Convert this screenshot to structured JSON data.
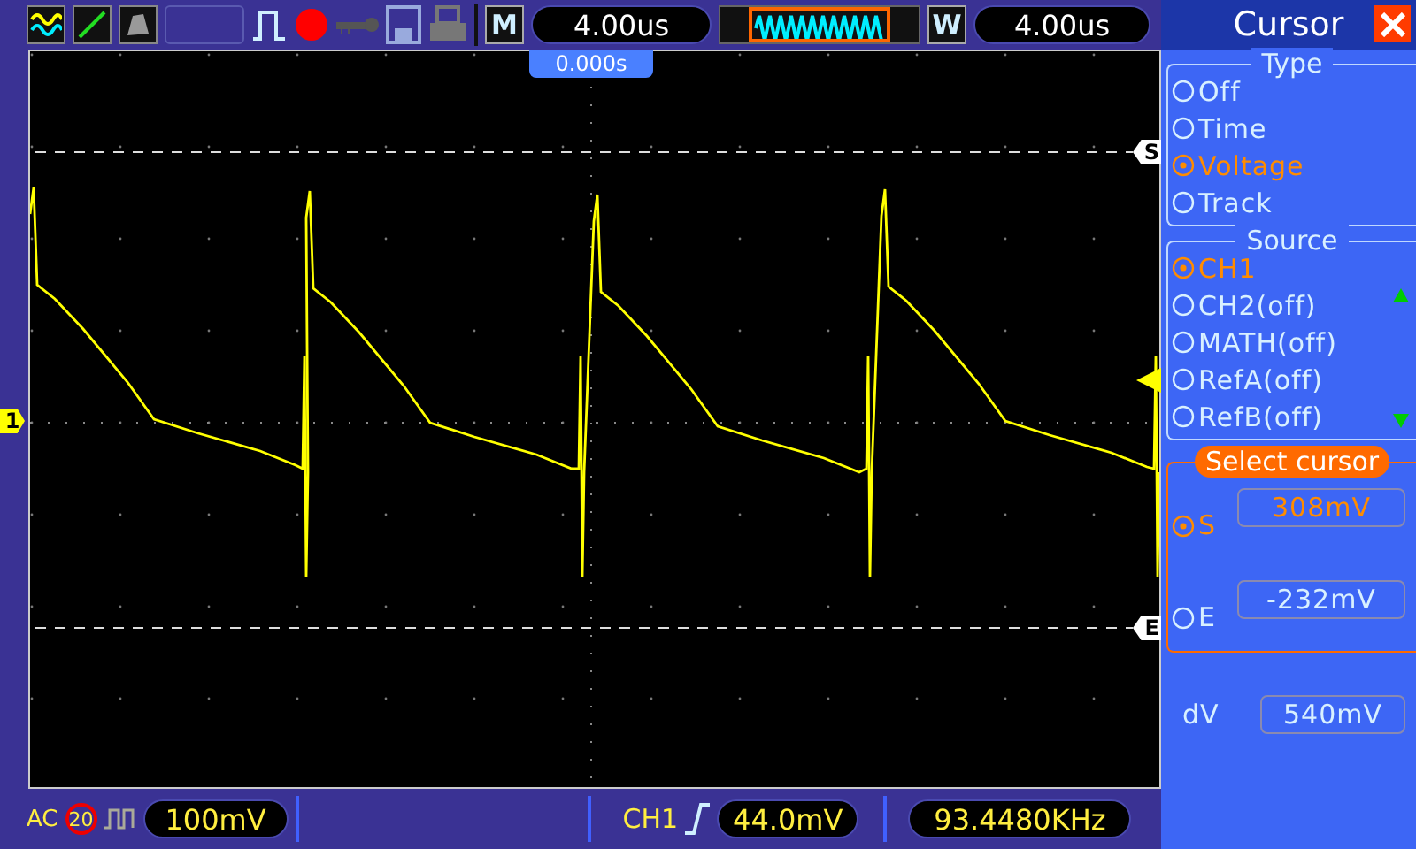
{
  "top_bar": {
    "mode_label": "M",
    "main_timebase": "4.00us",
    "window_label": "W",
    "window_timebase": "4.00us",
    "running": true
  },
  "screen": {
    "trigger_position": "0.000s",
    "channel_marker": "1",
    "start_cursor_marker": "S",
    "end_cursor_marker": "E"
  },
  "panel": {
    "title": "Cursor",
    "type_group": {
      "title": "Type",
      "options": [
        {
          "label": "Off",
          "selected": false
        },
        {
          "label": "Time",
          "selected": false
        },
        {
          "label": "Voltage",
          "selected": true
        },
        {
          "label": "Track",
          "selected": false
        }
      ]
    },
    "source_group": {
      "title": "Source",
      "options": [
        {
          "label": "CH1",
          "selected": true
        },
        {
          "label": "CH2(off)",
          "selected": false
        },
        {
          "label": "MATH(off)",
          "selected": false
        },
        {
          "label": "RefA(off)",
          "selected": false
        },
        {
          "label": "RefB(off)",
          "selected": false
        }
      ]
    },
    "select_group": {
      "title": "Select cursor",
      "cursors": [
        {
          "label": "S",
          "value": "308mV",
          "selected": true
        },
        {
          "label": "E",
          "value": "-232mV",
          "selected": false
        }
      ]
    },
    "delta": {
      "label": "dV",
      "value": "540mV"
    }
  },
  "bottom_bar": {
    "coupling": "AC",
    "bandwidth_limit": "20",
    "ch1_scale": "100mV",
    "trigger_source": "CH1",
    "trigger_level": "44.0mV",
    "frequency": "93.4480KHz"
  }
}
